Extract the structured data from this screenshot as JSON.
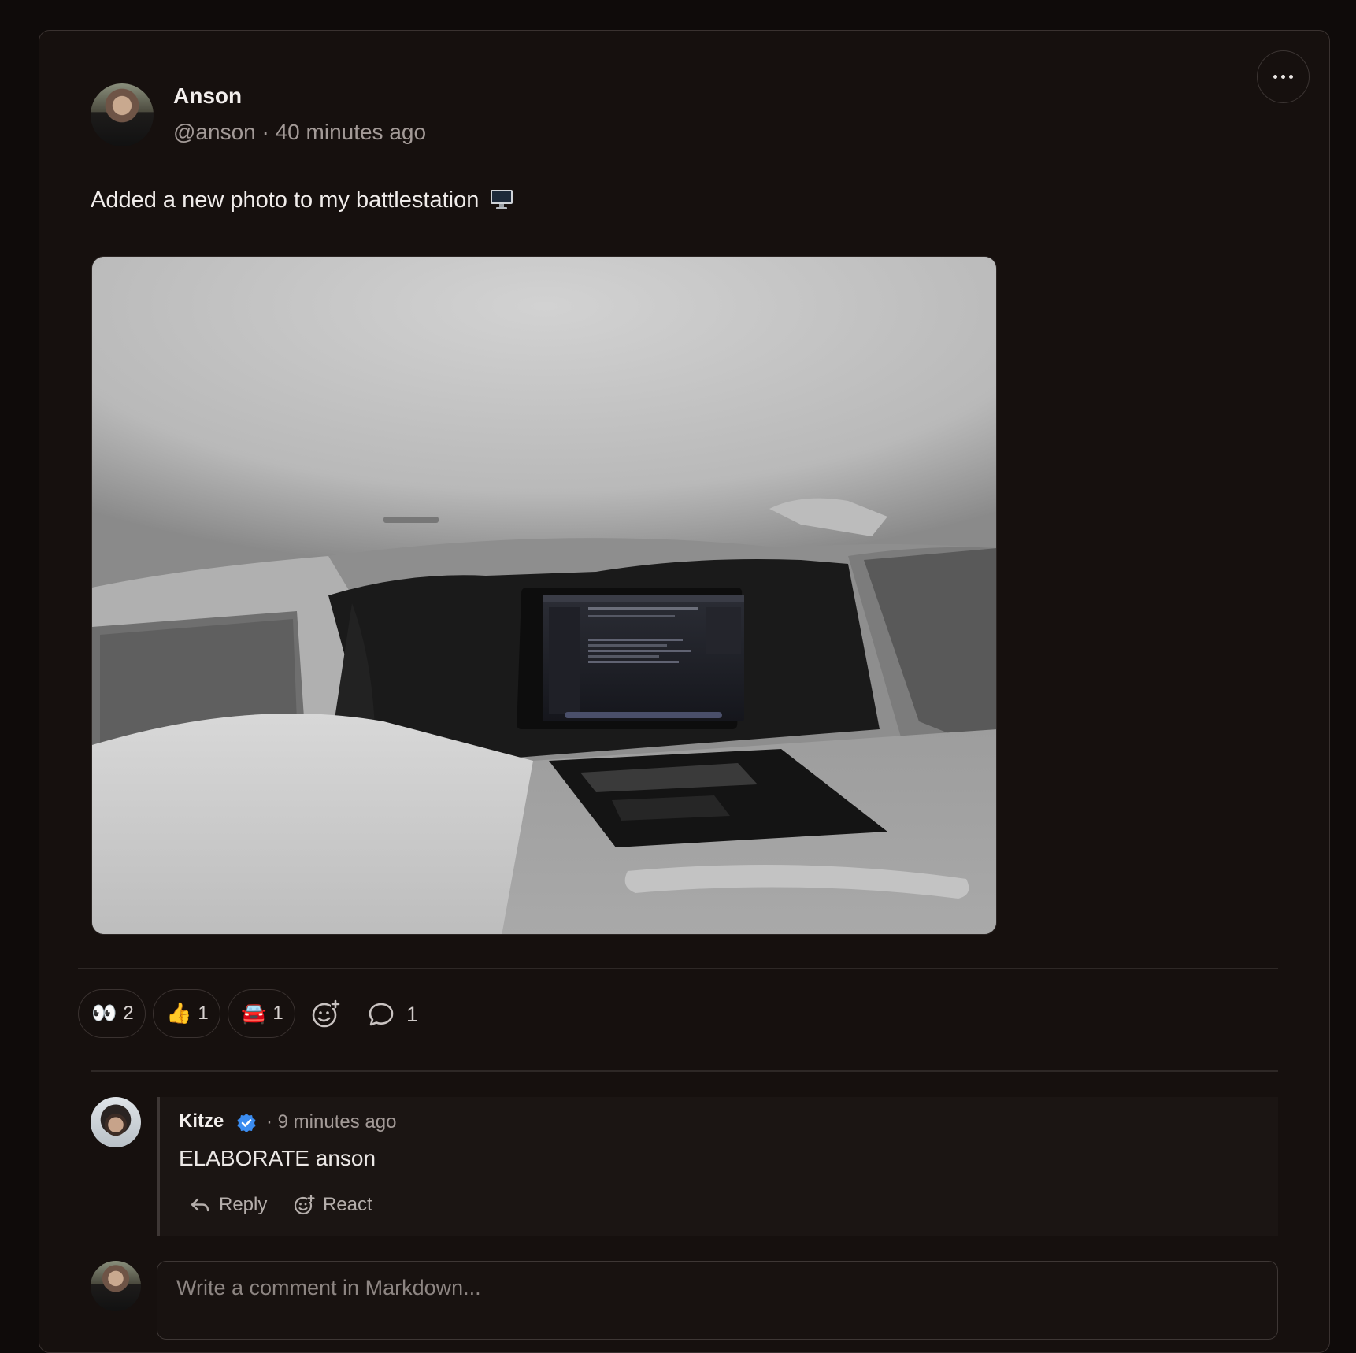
{
  "post": {
    "author_name": "Anson",
    "author_meta": "@anson · 40 minutes ago",
    "text": "Added a new photo to my battlestation",
    "photo_alt": "Laptop on a tray table inside a car camper setup"
  },
  "reactions": [
    {
      "emoji": "👀",
      "count": "2"
    },
    {
      "emoji": "👍",
      "count": "1"
    },
    {
      "emoji": "🚘",
      "count": "1"
    }
  ],
  "comment_count": "1",
  "comment": {
    "author_name": "Kitze",
    "meta": "· 9 minutes ago",
    "text": "ELABORATE anson",
    "reply_label": "Reply",
    "react_label": "React"
  },
  "composer": {
    "placeholder": "Write a comment in Markdown..."
  },
  "colors": {
    "background": "#0f0b0a",
    "card": "#16100e",
    "verified_badge": "#3b8cf0"
  }
}
